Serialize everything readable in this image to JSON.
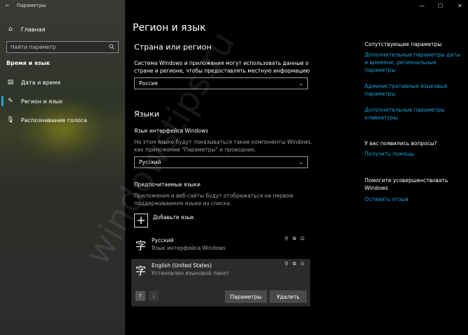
{
  "window": {
    "title": "Параметры",
    "minimize_glyph": "—",
    "maximize_glyph": "☐",
    "close_glyph": "✕"
  },
  "sidebar": {
    "home_label": "Главная",
    "search_placeholder": "Найти параметр",
    "section_title": "Время и язык",
    "items": [
      {
        "label": "Дата и время",
        "icon": "calendar-icon"
      },
      {
        "label": "Регион и язык",
        "icon": "region-pen-icon",
        "selected": true
      },
      {
        "label": "Распознавание голоса",
        "icon": "microphone-icon"
      }
    ]
  },
  "main": {
    "title": "Регион и язык",
    "country_heading": "Страна или регион",
    "country_desc": "Система Windows и приложения могут использовать данные о стране и регионе, чтобы предоставлять местную информацию",
    "country_value": "Россия",
    "languages_heading": "Языки",
    "interface_lang_label": "Язык интерфейса Windows",
    "interface_lang_desc": "На этом языке будут показываться такие компоненты Windows, как приложение \"Параметры\" и проводник.",
    "interface_lang_value": "Русский",
    "preferred_label": "Предпочитаемые языки",
    "preferred_desc": "Приложения и веб-сайты будут отображаться на первом поддерживаемом языке из списка.",
    "add_language_label": "Добавьте язык",
    "languages": [
      {
        "name": "Русский",
        "sub": "Язык интерфейса Windows",
        "icons": "⚲ ⧉ ⊡"
      },
      {
        "name": "English (United States)",
        "sub": "Установлен языковой пакет",
        "icons": "⚲ ⧉ ⊙"
      }
    ],
    "options_button": "Параметры",
    "remove_button": "Удалить"
  },
  "related": {
    "heading": "Сопутствующие параметры",
    "links": [
      "Дополнительные параметры даты и времени, региональные параметры",
      "Административные языковые параметры",
      "Дополнительные параметры клавиатуры"
    ],
    "question_heading": "У вас появились вопросы?",
    "help_link": "Получить помощь",
    "improve_heading": "Помогите усовершенствовать Windows",
    "feedback_link": "Оставить отзыв"
  },
  "watermark": "windowstips.ru"
}
